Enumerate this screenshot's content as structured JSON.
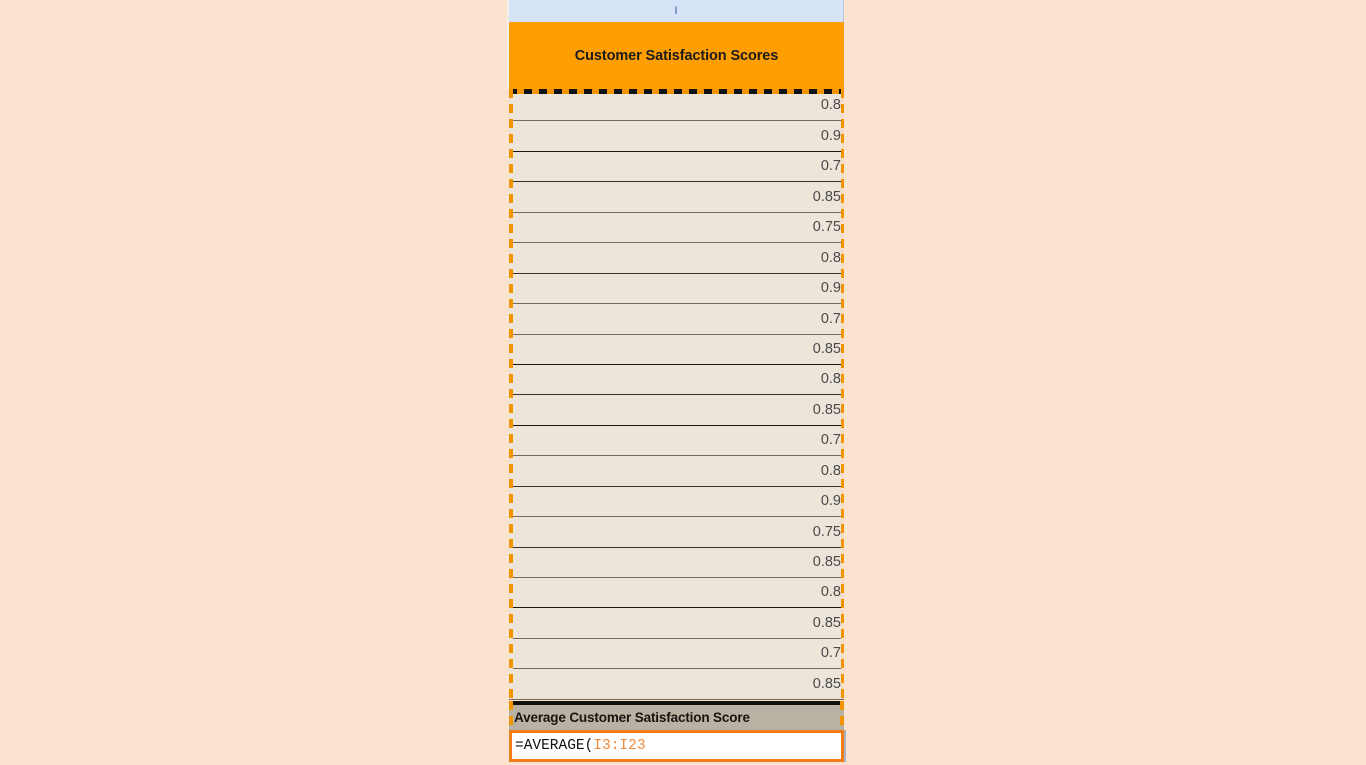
{
  "app": {
    "background_color": "#fce3d0",
    "cell_fill_color": "#ede5da",
    "accent_orange": "#ff9e00",
    "selection_orange": "#f29400",
    "formula_border_color": "#f07d1a",
    "label_row_color": "#b9b1a4"
  },
  "column": {
    "letter": "I",
    "header_background": "#d7e3f7"
  },
  "title_cell": {
    "text": "Customer Satisfaction Scores",
    "background": "#ff9e00"
  },
  "data": {
    "header": "Customer Satisfaction Scores",
    "range_label": "I3:I23",
    "row_count": 21,
    "values": [
      "0.8",
      "0.9",
      "0.7",
      "0.85",
      "0.75",
      "0.8",
      "0.9",
      "0.7",
      "0.85",
      "0.8",
      "0.85",
      "0.7",
      "0.8",
      "0.9",
      "0.75",
      "0.85",
      "0.8",
      "0.85",
      "0.7",
      "0.85"
    ]
  },
  "summary": {
    "label": "Average Customer Satisfaction Score"
  },
  "formula": {
    "function_part": "=AVERAGE(",
    "reference_part": "I3:I23",
    "full_text": "=AVERAGE(I3:I23"
  }
}
